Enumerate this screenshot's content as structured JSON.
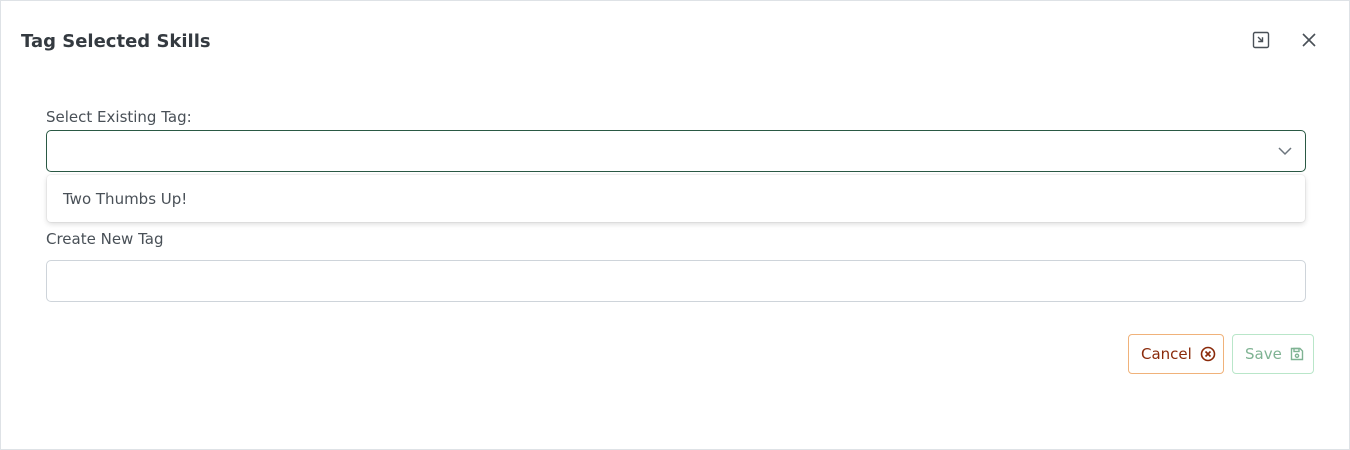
{
  "dialog": {
    "title": "Tag Selected Skills",
    "minimize_icon": "minimize-window-icon",
    "close_icon": "close-icon"
  },
  "existing_tag": {
    "label": "Select Existing Tag:",
    "selected_value": "",
    "chevron_icon": "chevron-down-icon",
    "options": [
      "Two Thumbs Up!"
    ]
  },
  "new_tag": {
    "label": "Create New Tag",
    "value": ""
  },
  "actions": {
    "cancel_label": "Cancel",
    "cancel_icon": "times-circle-icon",
    "save_label": "Save",
    "save_icon": "save-icon"
  },
  "colors": {
    "select_border": "#2a5944",
    "cancel_text": "#8a2a0a",
    "cancel_border": "#f0b27a",
    "save_text": "#7fb393",
    "save_border": "#b9e6c9"
  }
}
